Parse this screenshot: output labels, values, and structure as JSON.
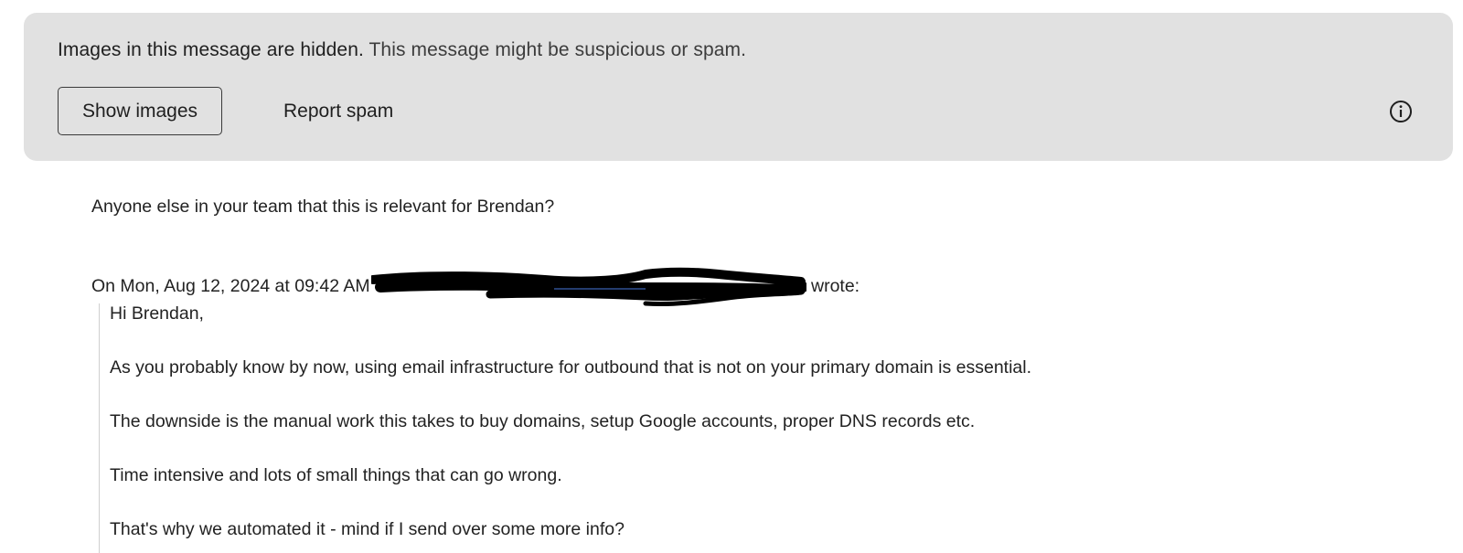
{
  "banner": {
    "strong_text": "Images in this message are hidden.",
    "rest_text": "This message might be suspicious or spam.",
    "show_images_label": "Show images",
    "report_spam_label": "Report spam",
    "info_icon": "info-circle-icon",
    "background_color": "#e1e1e1"
  },
  "message": {
    "reply_text": "Anyone else in your team that this is relevant for Brendan?",
    "quote_header_prefix": "On Mon, Aug 12, 2024 at 09:42 AM",
    "quote_header_suffix": "wrote:",
    "quoted_lines": [
      "Hi Brendan,",
      "As you probably know by now, using email infrastructure for outbound that is not on your primary domain is essential.",
      "The downside is the manual work this takes to buy domains, setup Google accounts, proper DNS records etc.",
      "Time intensive and lots of small things that can go wrong.",
      "That's why we automated it - mind if I send over some more info?"
    ]
  }
}
